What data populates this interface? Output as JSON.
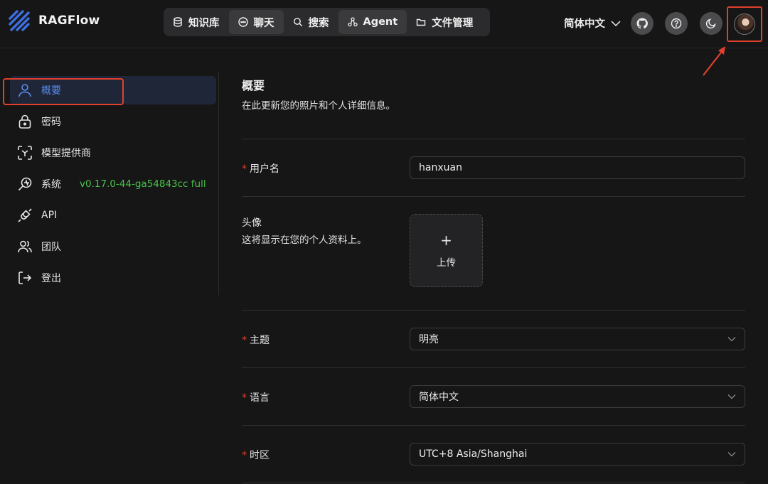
{
  "header": {
    "app_name": "RAGFlow",
    "nav": [
      {
        "label": "知识库",
        "icon": "database-icon"
      },
      {
        "label": "聊天",
        "icon": "chat-icon"
      },
      {
        "label": "搜索",
        "icon": "search-icon"
      },
      {
        "label": "Agent",
        "icon": "agent-icon"
      },
      {
        "label": "文件管理",
        "icon": "folder-icon"
      }
    ],
    "language": "简体中文",
    "icons": [
      "github-icon",
      "help-icon",
      "moon-icon",
      "avatar"
    ]
  },
  "sidebar": {
    "items": [
      {
        "label": "概要",
        "icon": "user-icon",
        "active": true
      },
      {
        "label": "密码",
        "icon": "lock-icon"
      },
      {
        "label": "模型提供商",
        "icon": "model-icon"
      },
      {
        "label": "系统",
        "icon": "system-icon",
        "version": "v0.17.0-44-ga54843cc full"
      },
      {
        "label": "API",
        "icon": "plug-icon"
      },
      {
        "label": "团队",
        "icon": "team-icon"
      },
      {
        "label": "登出",
        "icon": "logout-icon"
      }
    ]
  },
  "main": {
    "title": "概要",
    "subtitle": "在此更新您的照片和个人详细信息。",
    "username": {
      "required": "*",
      "label": "用户名",
      "value": "hanxuan"
    },
    "avatar": {
      "label": "头像",
      "help": "这将显示在您的个人资料上。",
      "plus": "+",
      "upload_label": "上传"
    },
    "theme": {
      "required": "*",
      "label": "主题",
      "value": "明亮"
    },
    "language": {
      "required": "*",
      "label": "语言",
      "value": "简体中文"
    },
    "timezone": {
      "required": "*",
      "label": "时区",
      "value": "UTC+8 Asia/Shanghai"
    }
  },
  "colors": {
    "accent": "#5a8dee",
    "highlight": "#e0402c",
    "version_green": "#49c24a",
    "background": "#161616"
  }
}
